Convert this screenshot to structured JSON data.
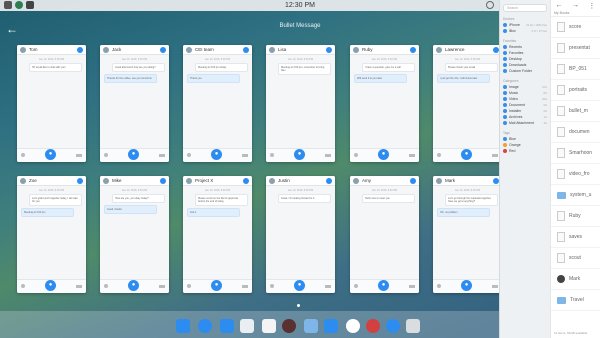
{
  "topbar": {
    "time": "12:30 PM"
  },
  "window": {
    "title": "Bullet Message"
  },
  "cards": [
    {
      "name": "Tom",
      "msgs": [
        "Jan 10, 2016, 5:30 PM",
        "Hi! would like to chat with you!"
      ]
    },
    {
      "name": "Jack",
      "msgs": [
        "Jan 10, 2016, 5:30 PM",
        "Good afternoon! how are you doing?",
        "Thanks for the coffee, see you tomorrow"
      ]
    },
    {
      "name": "CEI team",
      "msgs": [
        "Jan 10, 2016, 5:30 PM",
        "Meeting at 3:00 pm today",
        "Thank you"
      ]
    },
    {
      "name": "Lisa",
      "msgs": [
        "Jan 10, 2016, 5:30 PM",
        "Meeting at 3:00 pm, remember to bring files"
      ]
    },
    {
      "name": "Ruby",
      "msgs": [
        "Jan 10, 2016, 5:30 PM",
        "I have a question, give me a call",
        "Will send it to you later"
      ]
    },
    {
      "name": "Lawrence",
      "msgs": [
        "Jan 10, 2016, 5:30 PM",
        "Please check your email",
        "I just got the info, I will check later"
      ]
    },
    {
      "name": "Zoe",
      "msgs": [
        "Jan 10, 2016, 5:30 PM",
        "Let's grab lunch together today, I will wait for you",
        "Meeting at 3:00 pm"
      ]
    },
    {
      "name": "Mike",
      "msgs": [
        "Jan 10, 2016, 5:30 PM",
        "How are you, you okay today?",
        "Good, thanks"
      ]
    },
    {
      "name": "Project X",
      "msgs": [
        "Jan 10, 2016, 5:30 PM",
        "Please send me the file for approval before the end of today",
        "Got it"
      ]
    },
    {
      "name": "Justin",
      "msgs": [
        "Jan 10, 2016, 5:30 PM",
        "Great, I'm looking forward to it"
      ]
    },
    {
      "name": "Amy",
      "msgs": [
        "Jan 10, 2016, 5:30 PM",
        "Hello nice to meet you"
      ]
    },
    {
      "name": "Mark",
      "msgs": [
        "Jan 10, 2016, 5:30 PM",
        "Let's go through the materials together, have we got everything?",
        "OK, no problem"
      ]
    }
  ],
  "sidebar": {
    "search_placeholder": "Search",
    "devices_title": "Devices",
    "devices": [
      {
        "label": "iPhone",
        "count": "64.2G / 128G free"
      },
      {
        "label": "iBox",
        "count": "2.1T / 4T free"
      }
    ],
    "favorites_title": "Favorites",
    "favorites": [
      "Recents",
      "Favorites",
      "Desktop",
      "Downloads",
      "Custom Folder"
    ],
    "categories_title": "Categories",
    "categories": [
      {
        "label": "Image",
        "count": "10G"
      },
      {
        "label": "Music",
        "count": "8G"
      },
      {
        "label": "Video",
        "count": "22G"
      },
      {
        "label": "Document",
        "count": "5G"
      },
      {
        "label": "Installer",
        "count": "2G"
      },
      {
        "label": "Archives",
        "count": "1G"
      },
      {
        "label": "Mail Attachment",
        "count": "3G"
      }
    ],
    "tags_title": "Tags",
    "tags": [
      {
        "label": "Blue",
        "color": "#3b8ee8"
      },
      {
        "label": "Orange",
        "color": "#f0a030"
      },
      {
        "label": "Red",
        "color": "#e04040"
      }
    ]
  },
  "files": {
    "nav": [
      "←",
      "→",
      "⋮"
    ],
    "subtitle": "My Books",
    "items": [
      "score",
      "presentat",
      "BP_051",
      "portraits",
      "bullet_m",
      "documen",
      "Smarhoon",
      "video_fro",
      "system_u",
      "Ruby",
      "saves",
      "scout",
      "Mark",
      "Travel"
    ],
    "footer": "12 items, 64GB available"
  },
  "colors": {
    "accent": "#2d8cf0"
  }
}
